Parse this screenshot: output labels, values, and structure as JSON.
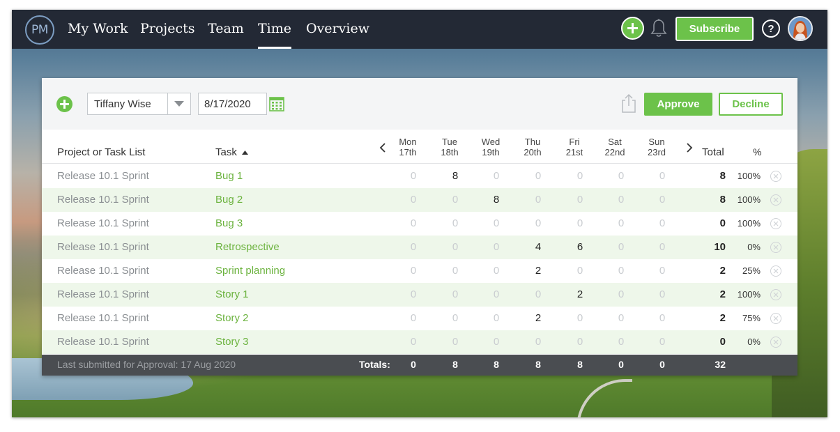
{
  "nav": {
    "logo": "PM",
    "links": [
      "My Work",
      "Projects",
      "Team",
      "Time",
      "Overview"
    ],
    "active": "Time",
    "subscribe_label": "Subscribe",
    "help_label": "?"
  },
  "toolbar": {
    "user": "Tiffany Wise",
    "date": "8/17/2020",
    "approve_label": "Approve",
    "decline_label": "Decline"
  },
  "table": {
    "col_project": "Project or Task List",
    "col_task": "Task",
    "days": [
      {
        "dow": "Mon",
        "date": "17th"
      },
      {
        "dow": "Tue",
        "date": "18th"
      },
      {
        "dow": "Wed",
        "date": "19th"
      },
      {
        "dow": "Thu",
        "date": "20th"
      },
      {
        "dow": "Fri",
        "date": "21st"
      },
      {
        "dow": "Sat",
        "date": "22nd"
      },
      {
        "dow": "Sun",
        "date": "23rd"
      }
    ],
    "col_total": "Total",
    "col_pct": "%",
    "rows": [
      {
        "project": "Release 10.1 Sprint",
        "task": "Bug 1",
        "hours": [
          "0",
          "8",
          "0",
          "0",
          "0",
          "0",
          "0"
        ],
        "total": "8",
        "pct": "100%"
      },
      {
        "project": "Release 10.1 Sprint",
        "task": "Bug 2",
        "hours": [
          "0",
          "0",
          "8",
          "0",
          "0",
          "0",
          "0"
        ],
        "total": "8",
        "pct": "100%"
      },
      {
        "project": "Release 10.1 Sprint",
        "task": "Bug 3",
        "hours": [
          "0",
          "0",
          "0",
          "0",
          "0",
          "0",
          "0"
        ],
        "total": "0",
        "pct": "100%"
      },
      {
        "project": "Release 10.1 Sprint",
        "task": "Retrospective",
        "hours": [
          "0",
          "0",
          "0",
          "4",
          "6",
          "0",
          "0"
        ],
        "total": "10",
        "pct": "0%"
      },
      {
        "project": "Release 10.1 Sprint",
        "task": "Sprint planning",
        "hours": [
          "0",
          "0",
          "0",
          "2",
          "0",
          "0",
          "0"
        ],
        "total": "2",
        "pct": "25%"
      },
      {
        "project": "Release 10.1 Sprint",
        "task": "Story 1",
        "hours": [
          "0",
          "0",
          "0",
          "0",
          "2",
          "0",
          "0"
        ],
        "total": "2",
        "pct": "100%"
      },
      {
        "project": "Release 10.1 Sprint",
        "task": "Story 2",
        "hours": [
          "0",
          "0",
          "0",
          "2",
          "0",
          "0",
          "0"
        ],
        "total": "2",
        "pct": "75%"
      },
      {
        "project": "Release 10.1 Sprint",
        "task": "Story 3",
        "hours": [
          "0",
          "0",
          "0",
          "0",
          "0",
          "0",
          "0"
        ],
        "total": "0",
        "pct": "0%"
      }
    ],
    "footer": {
      "last_submitted": "Last submitted for Approval: 17 Aug 2020",
      "totals_label": "Totals:",
      "day_totals": [
        "0",
        "8",
        "8",
        "8",
        "8",
        "0",
        "0"
      ],
      "grand_total": "32"
    }
  },
  "colors": {
    "accent": "#6cc24a",
    "nav_bg": "#232935",
    "row_alt": "#eef7ea",
    "footer_bg": "#4a4d51"
  }
}
